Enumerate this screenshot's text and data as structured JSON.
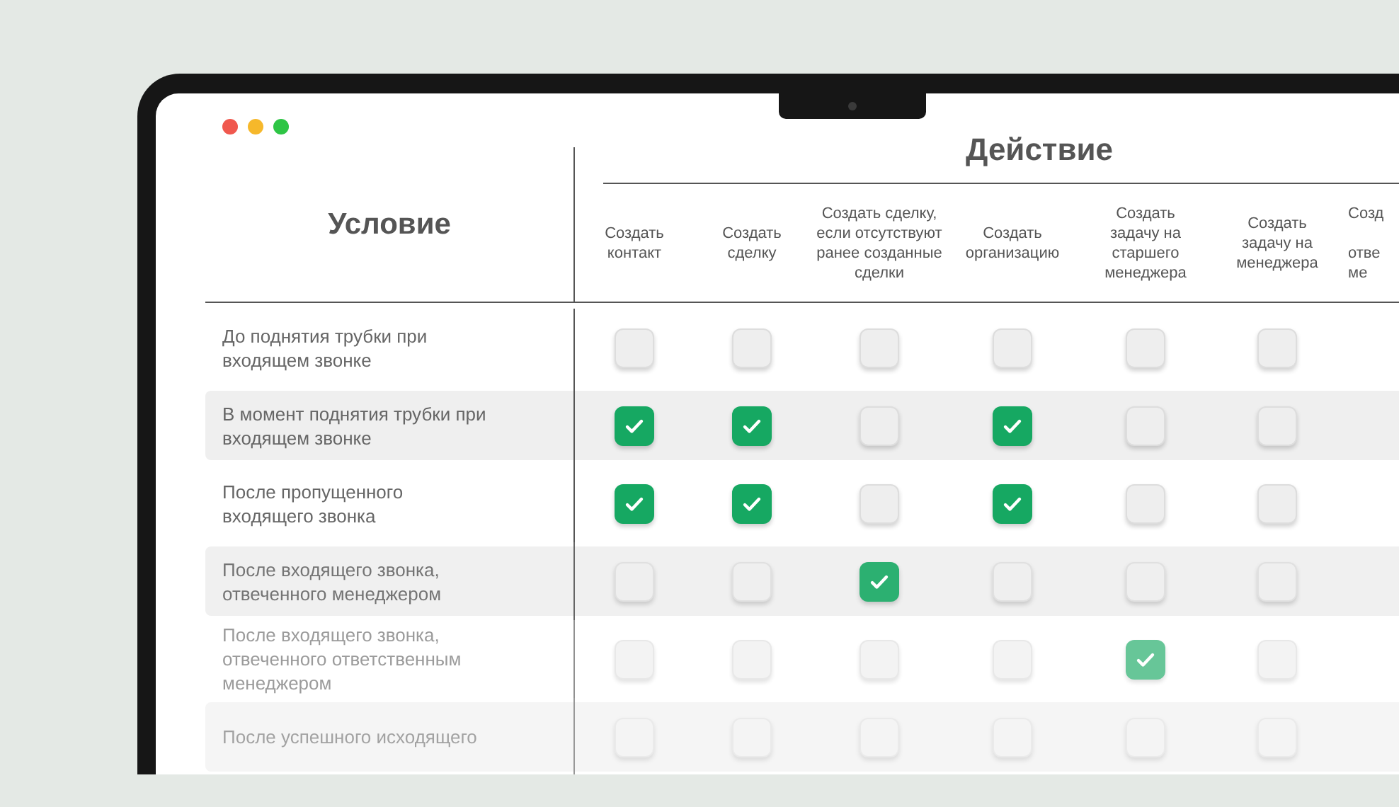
{
  "condition_header": "Условие",
  "action_header": "Действие",
  "columns": [
    {
      "label": "Создать\nконтакт"
    },
    {
      "label": "Создать\nсделку"
    },
    {
      "label": "Создать сделку,\nесли отсутствуют\nранее созданные\nсделки"
    },
    {
      "label": "Создать\nорганизацию"
    },
    {
      "label": "Создать\nзадачу на\nстаршего\nменеджера"
    },
    {
      "label": "Создать\nзадачу на\nменеджера"
    },
    {
      "label": "Созд\n\nотве\nме"
    }
  ],
  "rows": [
    {
      "condition": "До поднятия трубки при\nвходящем звонке",
      "actions": [
        {
          "checked": false
        },
        {
          "checked": false
        },
        {
          "checked": false
        },
        {
          "checked": false
        },
        {
          "checked": false
        },
        {
          "checked": false
        }
      ]
    },
    {
      "condition": "В момент поднятия трубки при\nвходящем звонке",
      "actions": [
        {
          "checked": true
        },
        {
          "checked": true
        },
        {
          "checked": false
        },
        {
          "checked": true
        },
        {
          "checked": false
        },
        {
          "checked": false
        }
      ]
    },
    {
      "condition": "После пропущенного\nвходящего звонка",
      "actions": [
        {
          "checked": true
        },
        {
          "checked": true
        },
        {
          "checked": false
        },
        {
          "checked": true
        },
        {
          "checked": false
        },
        {
          "checked": false
        }
      ]
    },
    {
      "condition": "После входящего звонка,\nотвеченного менеджером",
      "actions": [
        {
          "checked": false
        },
        {
          "checked": false
        },
        {
          "checked": true
        },
        {
          "checked": false
        },
        {
          "checked": false
        },
        {
          "checked": false
        }
      ]
    },
    {
      "condition": "После входящего звонка,\nотвеченного  ответственным\nменеджером",
      "actions": [
        {
          "checked": false
        },
        {
          "checked": false
        },
        {
          "checked": false
        },
        {
          "checked": false
        },
        {
          "checked": true
        },
        {
          "checked": false
        }
      ]
    },
    {
      "condition": "После успешного исходящего",
      "actions": [
        {
          "checked": false
        },
        {
          "checked": false
        },
        {
          "checked": false
        },
        {
          "checked": false
        },
        {
          "checked": false
        },
        {
          "checked": false
        }
      ]
    }
  ]
}
